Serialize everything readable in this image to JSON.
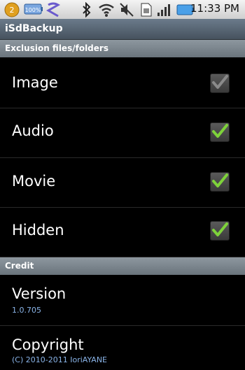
{
  "status_bar": {
    "time": "11:33 PM",
    "notification_badge": "2",
    "battery_notice": "100%",
    "icons": [
      "notification-icon",
      "battery-100-icon",
      "app-icon",
      "bluetooth-icon",
      "wifi-icon",
      "mute-icon",
      "sim-icon",
      "signal-icon",
      "battery-icon"
    ]
  },
  "app": {
    "title": "iSdBackup"
  },
  "sections": [
    {
      "header": "Exclusion files/folders"
    },
    {
      "header": "Credit"
    }
  ],
  "exclusions": [
    {
      "label": "Image",
      "checked": true,
      "enabled": false
    },
    {
      "label": "Audio",
      "checked": true,
      "enabled": true
    },
    {
      "label": "Movie",
      "checked": true,
      "enabled": true
    },
    {
      "label": "Hidden",
      "checked": true,
      "enabled": true
    }
  ],
  "credit": {
    "version_label": "Version",
    "version_value": "1.0.705",
    "copyright_label": "Copyright",
    "copyright_value": "(C) 2010-2011 IoriAYANE"
  },
  "colors": {
    "check_enabled": "#7ed23a",
    "check_disabled": "#8a8a8a",
    "subtext": "#8ab4e8"
  }
}
